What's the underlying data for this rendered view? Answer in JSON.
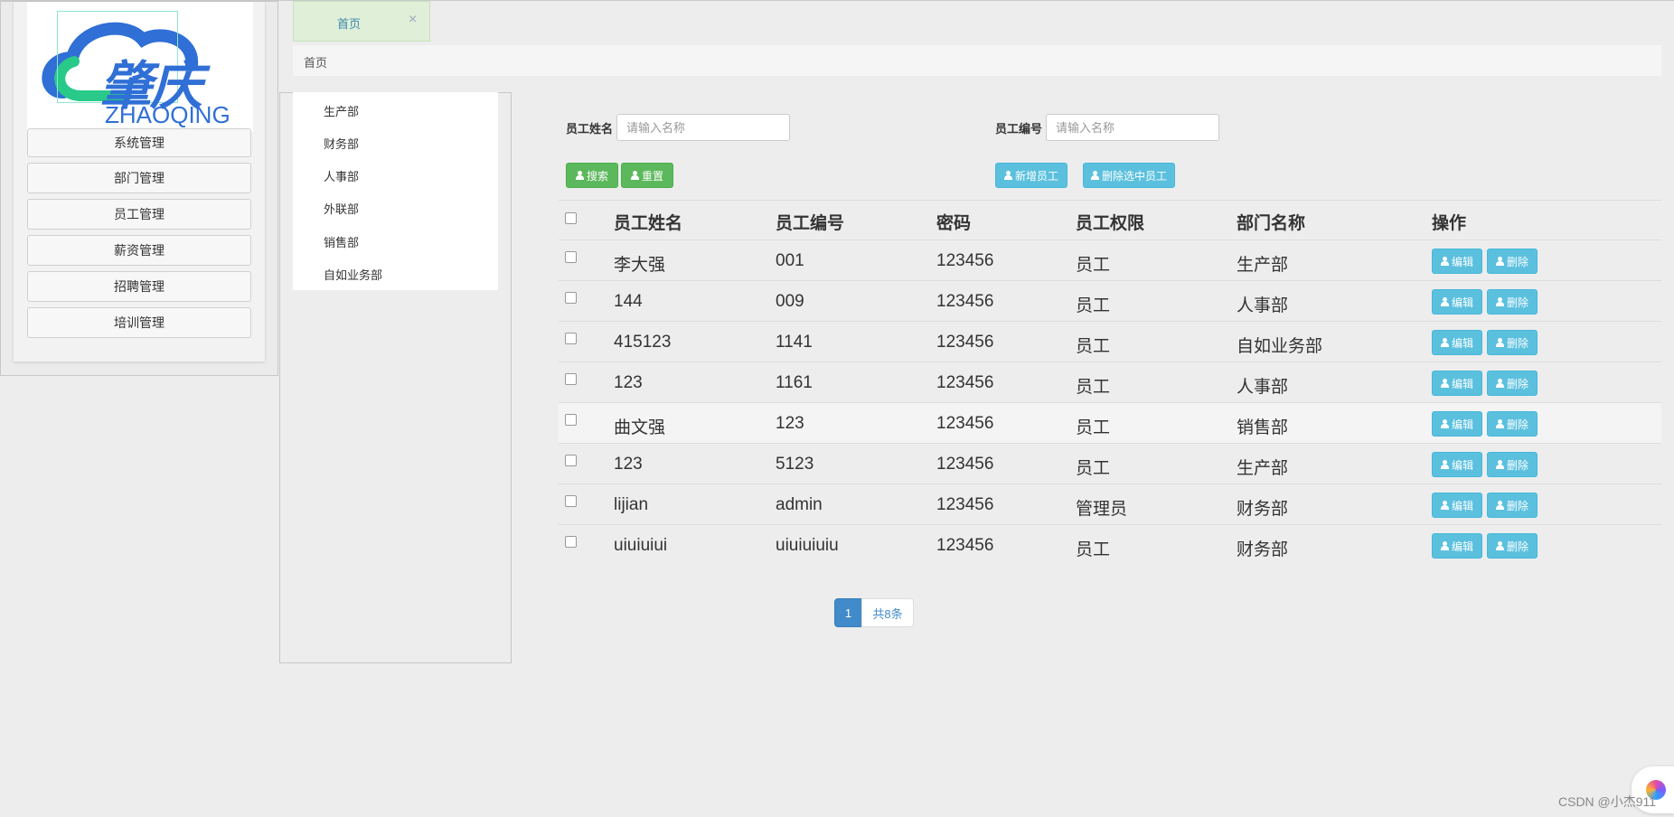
{
  "logo": {
    "title": "肇庆",
    "subtitle": "ZHAOQING"
  },
  "sidebar": {
    "items": [
      {
        "label": "系统管理"
      },
      {
        "label": "部门管理"
      },
      {
        "label": "员工管理"
      },
      {
        "label": "薪资管理"
      },
      {
        "label": "招聘管理"
      },
      {
        "label": "培训管理"
      }
    ]
  },
  "tabs": [
    {
      "label": "首页",
      "close": "×"
    }
  ],
  "breadcrumb": "首页",
  "departments": [
    "生产部",
    "财务部",
    "人事部",
    "外联部",
    "销售部",
    "自如业务部"
  ],
  "search": {
    "name_label": "员工姓名",
    "name_placeholder": "请输入名称",
    "id_label": "员工编号",
    "id_placeholder": "请输入名称",
    "search_button": "搜索",
    "reset_button": "重置",
    "add_button": "新增员工",
    "delete_selected_button": "删除选中员工"
  },
  "table": {
    "headers": {
      "name": "员工姓名",
      "id": "员工编号",
      "password": "密码",
      "role": "员工权限",
      "dept": "部门名称",
      "ops": "操作"
    },
    "edit_label": "编辑",
    "delete_label": "删除",
    "rows": [
      {
        "name": "李大强",
        "id": "001",
        "password": "123456",
        "role": "员工",
        "dept": "生产部"
      },
      {
        "name": "144",
        "id": "009",
        "password": "123456",
        "role": "员工",
        "dept": "人事部"
      },
      {
        "name": "415123",
        "id": "1141",
        "password": "123456",
        "role": "员工",
        "dept": "自如业务部"
      },
      {
        "name": "123",
        "id": "1161",
        "password": "123456",
        "role": "员工",
        "dept": "人事部"
      },
      {
        "name": "曲文强",
        "id": "123",
        "password": "123456",
        "role": "员工",
        "dept": "销售部"
      },
      {
        "name": "123",
        "id": "5123",
        "password": "123456",
        "role": "员工",
        "dept": "生产部"
      },
      {
        "name": "lijian",
        "id": "admin",
        "password": "123456",
        "role": "管理员",
        "dept": "财务部"
      },
      {
        "name": "uiuiuiui",
        "id": "uiuiuiuiu",
        "password": "123456",
        "role": "员工",
        "dept": "财务部"
      }
    ]
  },
  "pagination": {
    "current": "1",
    "total": "共8条"
  },
  "watermark": "CSDN @小杰911",
  "colors": {
    "primary": "#428bca",
    "success": "#5cb85c",
    "info": "#5bc0de",
    "logo": "#2f6fd6"
  }
}
